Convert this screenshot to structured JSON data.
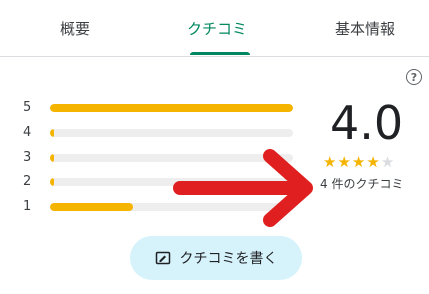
{
  "tabs": [
    {
      "label": "概要"
    },
    {
      "label": "クチコミ"
    },
    {
      "label": "基本情報"
    }
  ],
  "active_tab": "クチコミ",
  "help_icon": "question-circle-icon",
  "distribution": [
    {
      "label": "5",
      "fraction": 1.0
    },
    {
      "label": "4",
      "fraction": 0.0
    },
    {
      "label": "3",
      "fraction": 0.0
    },
    {
      "label": "2",
      "fraction": 0.0
    },
    {
      "label": "1",
      "fraction": 0.34
    }
  ],
  "summary": {
    "score": "4.0",
    "stars_filled": 4,
    "stars_total": 5,
    "review_count": "4 件のクチコミ"
  },
  "write_review": {
    "label": "クチコミを書く",
    "icon": "write-review-icon"
  },
  "colors": {
    "accent": "#01875f",
    "star": "#f4b400",
    "arrow": "#e02020",
    "button_bg": "#d6f3fc"
  }
}
